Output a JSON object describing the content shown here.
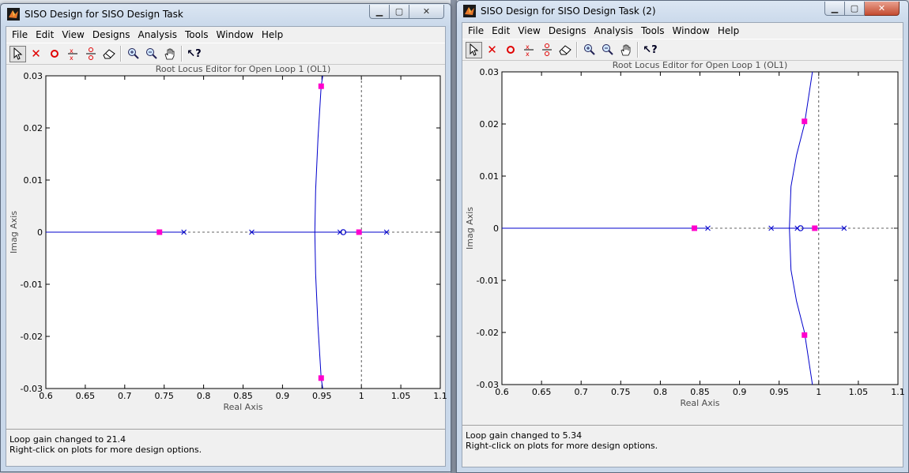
{
  "windows": [
    {
      "title": "SISO Design for SISO Design Task",
      "menu": [
        "File",
        "Edit",
        "View",
        "Designs",
        "Analysis",
        "Tools",
        "Window",
        "Help"
      ],
      "close_active": false,
      "status": [
        "Loop gain changed to 21.4",
        "Right-click on plots for more design options."
      ],
      "chart_data": {
        "type": "scatter",
        "title": "Root Locus Editor for Open Loop 1 (OL1)",
        "xlabel": "Real Axis",
        "ylabel": "Imag Axis",
        "xlim": [
          0.6,
          1.1
        ],
        "ylim": [
          -0.03,
          0.03
        ],
        "xticks": [
          "0.6",
          "0.65",
          "0.7",
          "0.75",
          "0.8",
          "0.85",
          "0.9",
          "0.95",
          "1",
          "1.05",
          "1.1"
        ],
        "yticks": [
          "0.03",
          "0.02",
          "0.01",
          "0",
          "-0.01",
          "-0.02",
          "-0.03"
        ],
        "grid": false,
        "unit_circle_x": 1.0,
        "real_axis_locus": [
          [
            0.6,
            0.775
          ],
          [
            0.861,
            0.973
          ],
          [
            0.98,
            1.032
          ]
        ],
        "branches": [
          [
            [
              0.951,
              0.03
            ],
            [
              0.949,
              0.028
            ],
            [
              0.945,
              0.018
            ],
            [
              0.942,
              0.008
            ],
            [
              0.941,
              0.0
            ],
            [
              0.942,
              -0.008
            ],
            [
              0.945,
              -0.018
            ],
            [
              0.949,
              -0.028
            ],
            [
              0.951,
              -0.03
            ]
          ]
        ],
        "poles": [
          [
            0.775,
            0
          ],
          [
            0.861,
            0
          ],
          [
            0.973,
            0
          ],
          [
            1.032,
            0
          ]
        ],
        "zeros": [
          [
            0.977,
            0
          ]
        ],
        "closed_loop_poles": [
          [
            0.744,
            0
          ],
          [
            0.949,
            0.028
          ],
          [
            0.949,
            -0.028
          ],
          [
            0.997,
            0
          ]
        ]
      }
    },
    {
      "title": "SISO Design for SISO Design Task (2)",
      "menu": [
        "File",
        "Edit",
        "View",
        "Designs",
        "Analysis",
        "Tools",
        "Window",
        "Help"
      ],
      "close_active": true,
      "status": [
        "Loop gain changed to 5.34",
        "Right-click on plots for more design options."
      ],
      "chart_data": {
        "type": "scatter",
        "title": "Root Locus Editor for Open Loop 1 (OL1)",
        "xlabel": "Real Axis",
        "ylabel": "Imag Axis",
        "xlim": [
          0.6,
          1.1
        ],
        "ylim": [
          -0.03,
          0.03
        ],
        "xticks": [
          "0.6",
          "0.65",
          "0.7",
          "0.75",
          "0.8",
          "0.85",
          "0.9",
          "0.95",
          "1",
          "1.05",
          "1.1"
        ],
        "yticks": [
          "0.03",
          "0.02",
          "0.01",
          "0",
          "-0.01",
          "-0.02",
          "-0.03"
        ],
        "grid": false,
        "unit_circle_x": 1.0,
        "real_axis_locus": [
          [
            0.6,
            0.86
          ],
          [
            0.94,
            0.973
          ],
          [
            0.98,
            1.032
          ]
        ],
        "branches": [
          [
            [
              0.992,
              0.03
            ],
            [
              0.988,
              0.026
            ],
            [
              0.982,
              0.02
            ],
            [
              0.972,
              0.014
            ],
            [
              0.965,
              0.008
            ],
            [
              0.963,
              0.0
            ],
            [
              0.965,
              -0.008
            ],
            [
              0.972,
              -0.014
            ],
            [
              0.982,
              -0.02
            ],
            [
              0.988,
              -0.026
            ],
            [
              0.992,
              -0.03
            ]
          ]
        ],
        "poles": [
          [
            0.86,
            0
          ],
          [
            0.94,
            0
          ],
          [
            0.973,
            0
          ],
          [
            1.032,
            0
          ]
        ],
        "zeros": [
          [
            0.977,
            0
          ]
        ],
        "closed_loop_poles": [
          [
            0.843,
            0
          ],
          [
            0.982,
            0.0205
          ],
          [
            0.982,
            -0.0205
          ],
          [
            0.995,
            0
          ]
        ]
      }
    }
  ],
  "toolbar_icons": [
    "arrow-select-icon",
    "delete-x-pole-icon",
    "add-zero-icon",
    "add-pole-pair-icon",
    "add-zero-pair-icon",
    "eraser-icon",
    "zoom-in-icon",
    "zoom-out-icon",
    "pan-hand-icon",
    "whats-this-help-icon"
  ],
  "colors": {
    "locus": "#0000cc",
    "closed_loop_pole": "#ff00cc",
    "axis_dashed": "#333333",
    "plot_background": "#ffffff",
    "title_gray": "#4d4d4d"
  }
}
